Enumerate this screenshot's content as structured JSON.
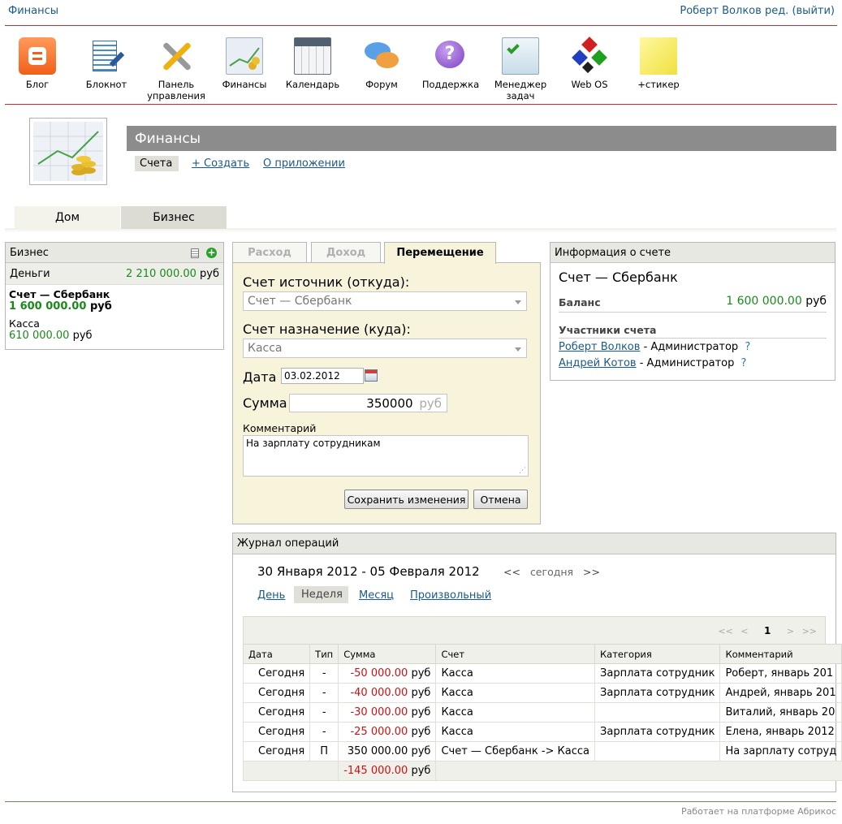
{
  "header": {
    "site_title": "Финансы",
    "user_name": "Роберт Волков",
    "user_role": "ред.",
    "logout_label": "(выйти)"
  },
  "apps": [
    {
      "label": "Блог",
      "icon": "blog-icon"
    },
    {
      "label": "Блокнот",
      "icon": "notepad-icon"
    },
    {
      "label": "Панель управления",
      "icon": "control-panel-icon"
    },
    {
      "label": "Финансы",
      "icon": "finance-icon"
    },
    {
      "label": "Календарь",
      "icon": "calendar-icon"
    },
    {
      "label": "Форум",
      "icon": "forum-icon"
    },
    {
      "label": "Поддержка",
      "icon": "support-icon"
    },
    {
      "label": "Менеджер задач",
      "icon": "task-manager-icon"
    },
    {
      "label": "Web OS",
      "icon": "web-os-icon"
    },
    {
      "label": "+стикер",
      "icon": "sticker-icon"
    }
  ],
  "app_header": {
    "title": "Финансы",
    "tabs": {
      "accounts": "Счета",
      "create": "+ Создать",
      "about": "О приложении"
    }
  },
  "category_tabs": [
    {
      "label": "Дом"
    },
    {
      "label": "Бизнес"
    }
  ],
  "accounts_panel": {
    "title": "Бизнес",
    "money_label": "Деньги",
    "money_total": "2 210 000.00",
    "currency": "руб",
    "accounts": [
      {
        "name": "Счет — Сбербанк",
        "amount": "1 600 000.00",
        "currency": "руб"
      },
      {
        "name": "Касса",
        "amount": "610 000.00",
        "currency": "руб"
      }
    ]
  },
  "form": {
    "tabs": [
      "Расход",
      "Доход",
      "Перемещение"
    ],
    "source_label": "Счет источник (откуда):",
    "source_value": "Счет — Сбербанк",
    "dest_label": "Счет назначение (куда):",
    "dest_value": "Касса",
    "date_label": "Дата",
    "date_value": "03.02.2012",
    "sum_label": "Сумма",
    "sum_value": "350000",
    "sum_currency": "руб",
    "comment_label": "Комментарий",
    "comment_value": "На зарплату сотрудникам",
    "save_label": "Сохранить изменения",
    "cancel_label": "Отмена"
  },
  "account_info": {
    "panel_title": "Информация о счете",
    "account_name": "Счет — Сбербанк",
    "balance_label": "Баланс",
    "balance_value": "1 600 000.00",
    "currency": "руб",
    "members_label": "Участники счета",
    "members": [
      {
        "name": "Роберт Волков",
        "role": "- Администратор",
        "help": "?"
      },
      {
        "name": "Андрей Котов",
        "role": "- Администратор",
        "help": "?"
      }
    ]
  },
  "journal": {
    "title": "Журнал операций",
    "period": "30 Января 2012 - 05 Февраля 2012",
    "nav_prev": "<<",
    "nav_today": "сегодня",
    "nav_next": ">>",
    "ranges": [
      "День",
      "Неделя",
      "Месяц",
      "Произвольный"
    ],
    "pager": {
      "first": "<<",
      "prev": "<",
      "page": "1",
      "next": ">",
      "last": ">>"
    },
    "columns": [
      "Дата",
      "Тип",
      "Сумма",
      "Счет",
      "Категория",
      "Комментарий"
    ],
    "rows": [
      {
        "date": "Сегодня",
        "type": "-",
        "amount": "-50 000.00",
        "currency": "руб",
        "account": "Касса",
        "category": "Зарплата сотрудник",
        "comment": "Роберт, январь 201"
      },
      {
        "date": "Сегодня",
        "type": "-",
        "amount": "-40 000.00",
        "currency": "руб",
        "account": "Касса",
        "category": "Зарплата сотрудник",
        "comment": "Андрей, январь 201"
      },
      {
        "date": "Сегодня",
        "type": "-",
        "amount": "-30 000.00",
        "currency": "руб",
        "account": "Касса",
        "category": "",
        "comment": "Виталий, январь 20"
      },
      {
        "date": "Сегодня",
        "type": "-",
        "amount": "-25 000.00",
        "currency": "руб",
        "account": "Касса",
        "category": "Зарплата сотрудник",
        "comment": "Елена, январь 2012"
      },
      {
        "date": "Сегодня",
        "type": "П",
        "amount": "350 000.00",
        "currency": "руб",
        "account": "Счет — Сбербанк -> Касса",
        "category": "",
        "comment": "На зарплату сотруд"
      }
    ],
    "total": "-145 000.00",
    "total_currency": "руб"
  },
  "footer": {
    "text": "Работает на платформе Абрикос"
  },
  "colors": {
    "accent_red": "#c03030",
    "positive": "#1a8a1a",
    "negative": "#d01010",
    "link": "#1a5a8a",
    "form_bg": "#f8f4dc"
  }
}
